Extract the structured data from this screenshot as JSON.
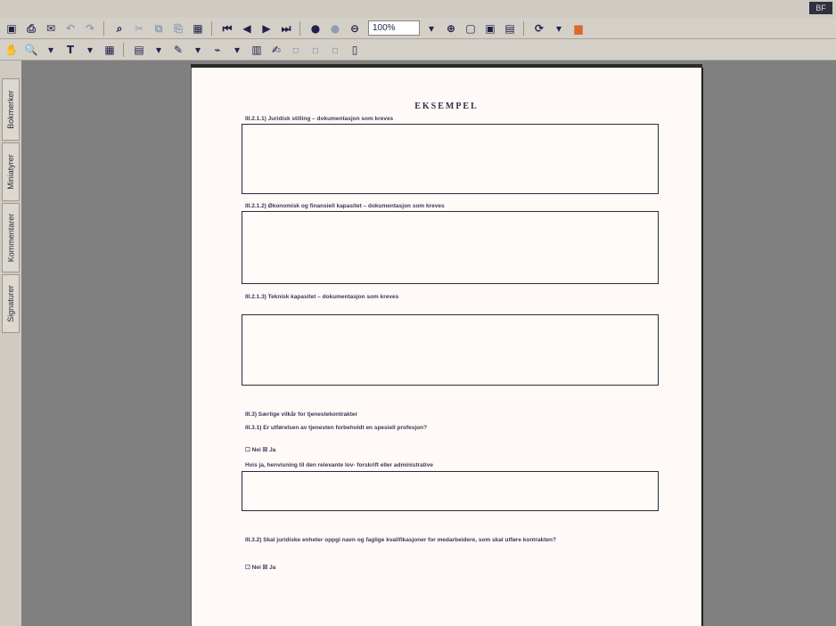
{
  "toolbar": {
    "zoom_value": "100%",
    "badge": "BF"
  },
  "sidebar": {
    "tabs": [
      "Bokmerker",
      "Miniatyrer",
      "Kommentarer",
      "Signaturer"
    ]
  },
  "document": {
    "title": "EKSEMPEL",
    "q1": "III.2.1.1) Juridisk stilling – dokumentasjon som kreves",
    "q2": "III.2.1.2) Økonomisk og finansiell kapasitet – dokumentasjon som kreves",
    "q3": "III.2.1.3) Teknisk kapasitet – dokumentasjon som kreves",
    "section": "III.3) Særlige vilkår for tjenestekontrakter",
    "q4": "III.3.1) Er utførelsen av tjenesten forbeholdt en spesiell profesjon?",
    "q4_answer": "☐ Nei ☒ Ja",
    "q4_followup": "Hvis ja, henvisning til den relevante lov- forskrift eller administrative",
    "q5": "III.3.2) Skal juridiske enheter oppgi navn og faglige kvalifikasjoner for medarbeidere, som skal utføre kontrakten?",
    "q5_answer": "☐ Nei ☒ Ja"
  }
}
